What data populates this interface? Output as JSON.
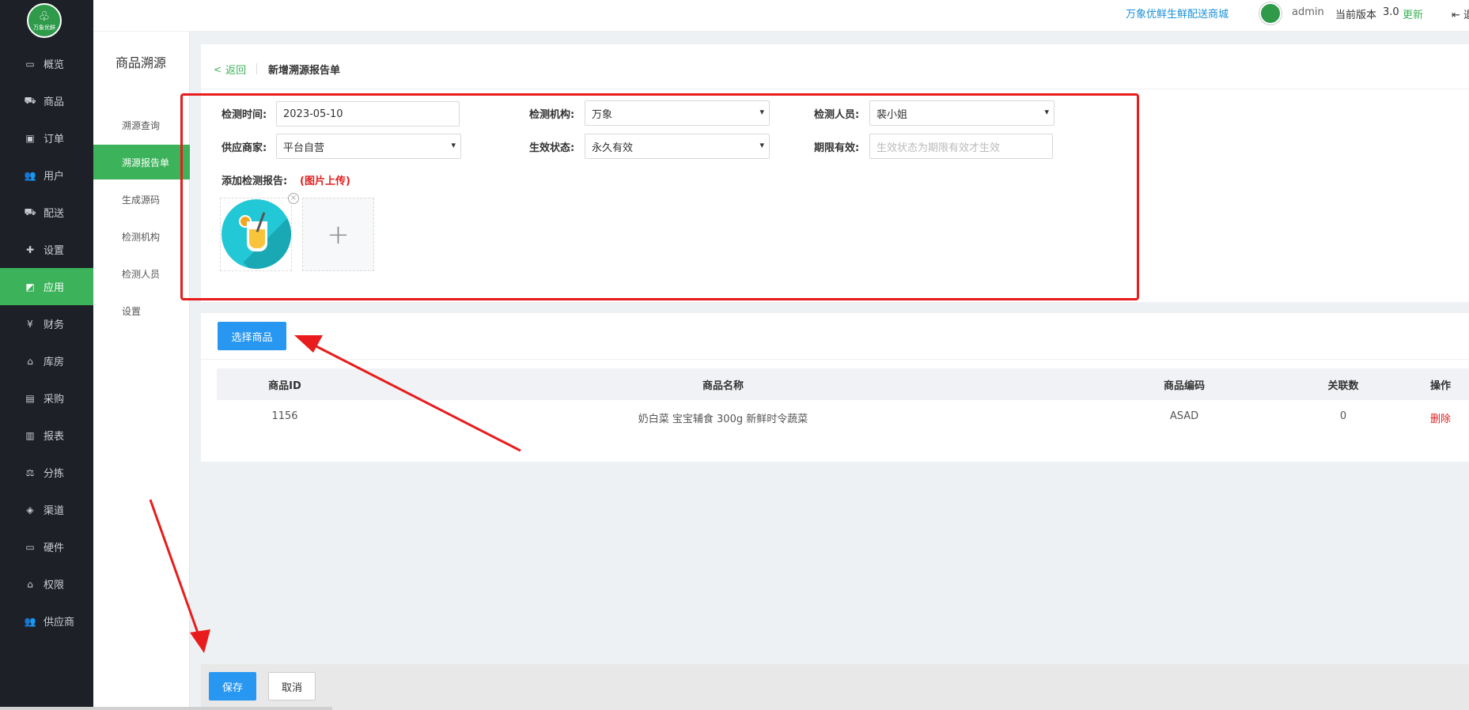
{
  "brand": {
    "logo_text": "万象优鲜"
  },
  "sidebar": {
    "items": [
      {
        "label": "概览",
        "icon": "monitor-icon",
        "glyph": "▭"
      },
      {
        "label": "商品",
        "icon": "cart-icon",
        "glyph": "⛟"
      },
      {
        "label": "订单",
        "icon": "order-icon",
        "glyph": "▣"
      },
      {
        "label": "用户",
        "icon": "users-icon",
        "glyph": "👥"
      },
      {
        "label": "配送",
        "icon": "truck-icon",
        "glyph": "⛟"
      },
      {
        "label": "设置",
        "icon": "puzzle-icon",
        "glyph": "✚"
      },
      {
        "label": "应用",
        "icon": "apps-icon",
        "glyph": "◩"
      },
      {
        "label": "财务",
        "icon": "yen-icon",
        "glyph": "¥"
      },
      {
        "label": "库房",
        "icon": "home-icon",
        "glyph": "⌂"
      },
      {
        "label": "采购",
        "icon": "bus-icon",
        "glyph": "▤"
      },
      {
        "label": "报表",
        "icon": "bar-chart-icon",
        "glyph": "▥"
      },
      {
        "label": "分拣",
        "icon": "scale-icon",
        "glyph": "⚖"
      },
      {
        "label": "渠道",
        "icon": "cube-icon",
        "glyph": "◈"
      },
      {
        "label": "硬件",
        "icon": "desktop-icon",
        "glyph": "▭"
      },
      {
        "label": "权限",
        "icon": "bank-icon",
        "glyph": "⌂"
      },
      {
        "label": "供应商",
        "icon": "group-icon",
        "glyph": "👥"
      }
    ],
    "active_index": 6
  },
  "subnav": {
    "title": "商品溯源",
    "items": [
      "溯源查询",
      "溯源报告单",
      "生成源码",
      "检测机构",
      "检测人员",
      "设置"
    ],
    "active_index": 1
  },
  "topbar": {
    "store_link": "万象优鲜生鲜配送商城",
    "username": "admin",
    "version_label": "当前版本",
    "version_number": "3.0",
    "update_label": "更新",
    "exit_label": "退"
  },
  "form": {
    "back_label": "返回",
    "page_title": "新增溯源报告单",
    "test_time_label": "检测时间:",
    "test_time_value": "2023-05-10",
    "test_org_label": "检测机构:",
    "test_org_value": "万象",
    "tester_label": "检测人员:",
    "tester_value": "裴小姐",
    "supplier_label": "供应商家:",
    "supplier_value": "平台自营",
    "status_label": "生效状态:",
    "status_value": "永久有效",
    "validity_label": "期限有效:",
    "validity_placeholder": "生效状态为期限有效才生效",
    "report_label": "添加检测报告:",
    "report_note": "(图片上传)",
    "add_glyph": "+",
    "remove_glyph": "×"
  },
  "products": {
    "select_button": "选择商品",
    "columns": [
      "商品ID",
      "商品名称",
      "商品编码",
      "关联数",
      "操作"
    ],
    "rows": [
      {
        "id": "1156",
        "name": "奶白菜 宝宝辅食 300g 新鲜时令蔬菜",
        "code": "ASAD",
        "count": "0",
        "action": "删除"
      }
    ]
  },
  "footer": {
    "save_label": "保存",
    "cancel_label": "取消"
  },
  "colors": {
    "accent_green": "#3cb35a",
    "primary_blue": "#2797f2",
    "annotation_red": "#e81c1c",
    "sidebar_dark": "#1d2127"
  }
}
